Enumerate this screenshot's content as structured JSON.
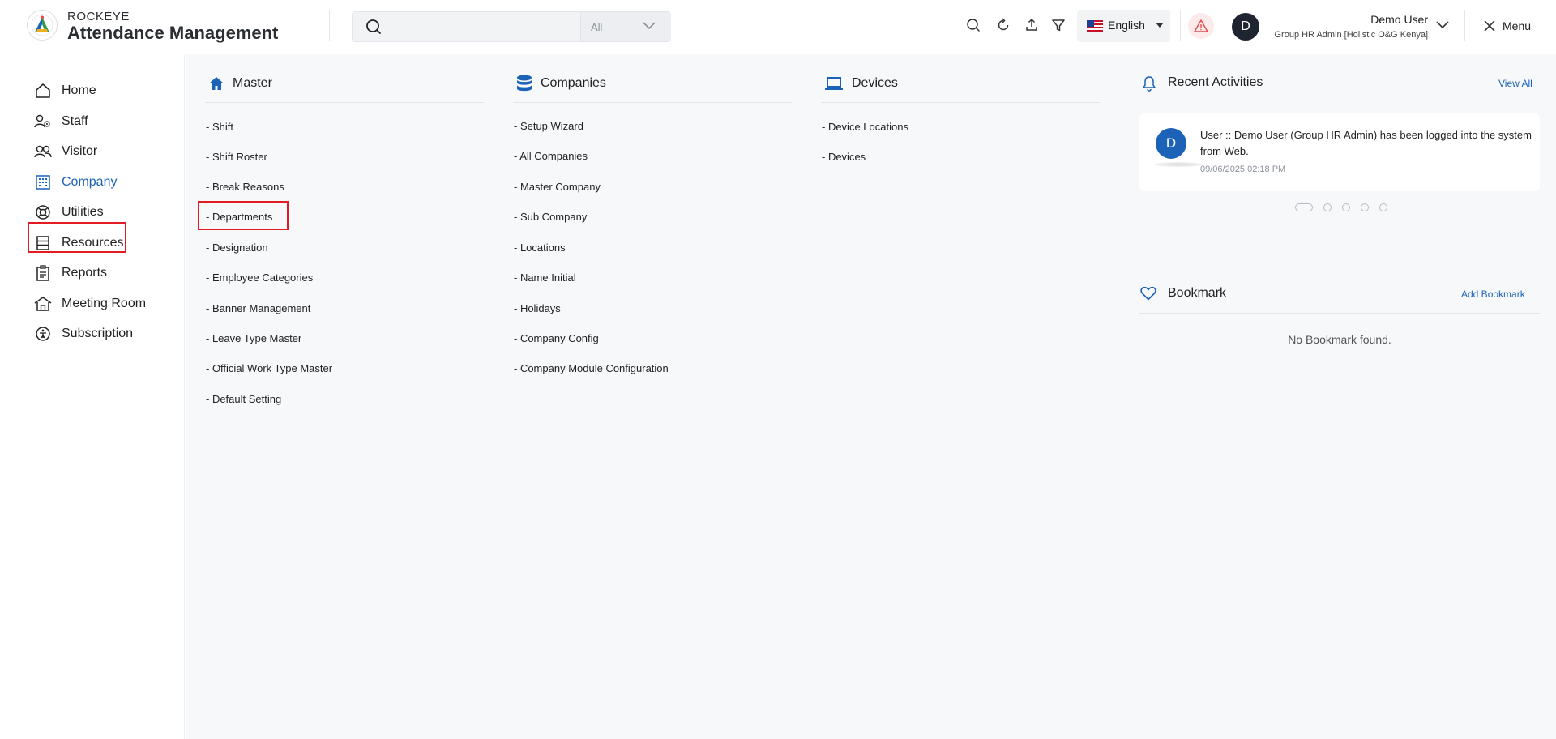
{
  "header": {
    "brand_small": "ROCKEYE",
    "brand_title": "Attendance Management",
    "search": {
      "value": "",
      "placeholder": "",
      "scope": "All"
    },
    "language": "English",
    "user": {
      "avatar_letter": "D",
      "name": "Demo User",
      "role": "Group HR Admin [Holistic O&G Kenya]"
    },
    "menu_label": "Menu"
  },
  "sidebar": {
    "items": [
      {
        "label": "Home",
        "icon": "home-icon"
      },
      {
        "label": "Staff",
        "icon": "staff-icon"
      },
      {
        "label": "Visitor",
        "icon": "visitor-icon"
      },
      {
        "label": "Company",
        "icon": "company-icon",
        "active": true
      },
      {
        "label": "Utilities",
        "icon": "utilities-icon"
      },
      {
        "label": "Resources",
        "icon": "resources-icon"
      },
      {
        "label": "Reports",
        "icon": "reports-icon"
      },
      {
        "label": "Meeting Room",
        "icon": "meeting-room-icon"
      },
      {
        "label": "Subscription",
        "icon": "subscription-icon"
      }
    ]
  },
  "columns": [
    {
      "title": "Master",
      "icon": "house-icon",
      "links": [
        "- Shift",
        "- Shift Roster",
        "- Break Reasons",
        "- Departments",
        "- Designation",
        "- Employee Categories",
        "- Banner Management",
        "- Leave Type Master",
        "- Official Work Type Master",
        "- Default Setting"
      ]
    },
    {
      "title": "Companies",
      "icon": "database-icon",
      "links": [
        "- Setup Wizard",
        "- All Companies",
        "- Master Company",
        "- Sub Company",
        "- Locations",
        "- Name Initial",
        "- Holidays",
        "- Company Config",
        "- Company Module Configuration"
      ]
    },
    {
      "title": "Devices",
      "icon": "laptop-icon",
      "links": [
        "- Device Locations",
        "- Devices"
      ]
    }
  ],
  "recent_activities": {
    "title": "Recent Activities",
    "view_all": "View All",
    "items": [
      {
        "avatar_letter": "D",
        "text": "User :: Demo User (Group HR Admin) has been logged into the system from Web.",
        "time": "09/06/2025 02:18 PM"
      }
    ],
    "pages": 5,
    "current_page": 1
  },
  "bookmark": {
    "title": "Bookmark",
    "add_label": "Add Bookmark",
    "empty_text": "No Bookmark found."
  },
  "colors": {
    "accent": "#1c63b7",
    "highlight": "#e31b23",
    "alert": "#e8474c"
  }
}
